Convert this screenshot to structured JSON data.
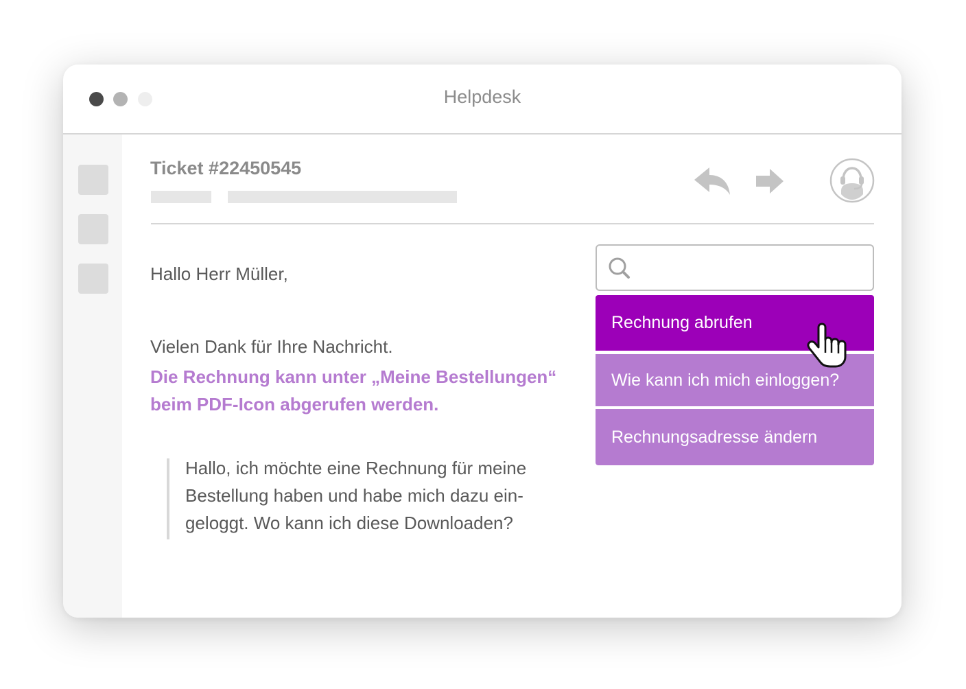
{
  "app": {
    "title": "Helpdesk"
  },
  "ticket": {
    "title": "Ticket #22450545"
  },
  "message": {
    "greeting": "Hallo Herr Müller,",
    "thanks": "Vielen Dank für Ihre Nachricht.",
    "answer": "Die Rechnung kann unter „Meine Bestellungen“ beim PDF-Icon abgerufen werden.",
    "quote": "Hallo, ich möchte eine Rechnung für meine Bestellung haben und habe mich dazu ein-geloggt. Wo kann ich diese Downloaden?"
  },
  "search": {
    "placeholder": "",
    "value": ""
  },
  "suggestions": [
    {
      "label": "Rechnung abrufen",
      "state": "active"
    },
    {
      "label": "Wie kann ich mich einloggen?",
      "state": "default"
    },
    {
      "label": "Rechnungsadresse ändern",
      "state": "default"
    }
  ],
  "icons": {
    "reply": "reply-icon",
    "forward": "forward-icon",
    "agent": "headset-agent-icon",
    "search": "search-icon",
    "cursor": "hand-pointer-cursor-icon"
  },
  "colors": {
    "accent_active": "#9c00b8",
    "accent": "#b57bd0",
    "text": "#595959",
    "muted": "#8c8c8c"
  }
}
